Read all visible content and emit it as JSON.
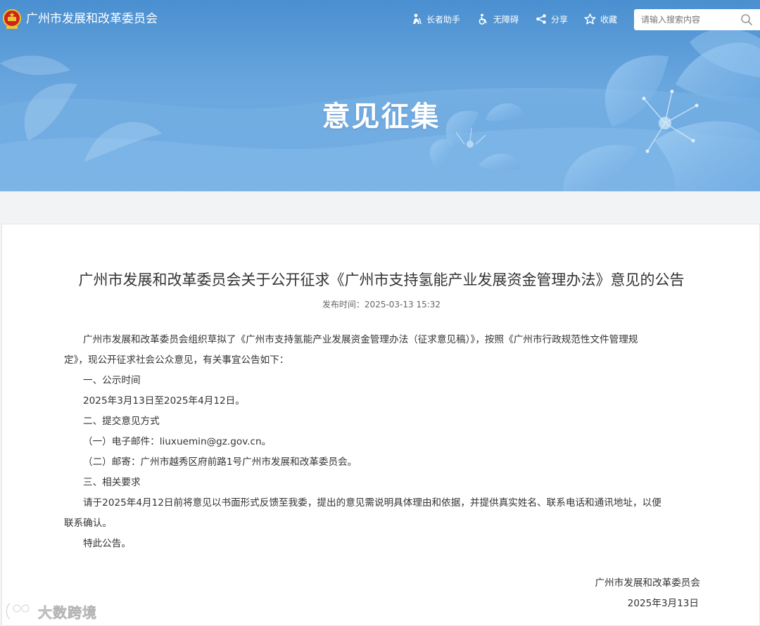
{
  "header": {
    "site_name": "广州市发展和改革委员会",
    "tools": {
      "elder": "长者助手",
      "accessibility": "无障碍",
      "share": "分享",
      "favorite": "收藏"
    },
    "search": {
      "placeholder": "请输入搜索内容"
    },
    "banner_title": "意见征集"
  },
  "article": {
    "title": "广州市发展和改革委员会关于公开征求《广州市支持氢能产业发展资金管理办法》意见的公告",
    "publish_time": "发布时间：2025-03-13 15:32",
    "paragraphs": [
      "广州市发展和改革委员会组织草拟了《广州市支持氢能产业发展资金管理办法（征求意见稿）》，按照《广州市行政规范性文件管理规",
      "定》，现公开征求社会公众意见，有关事宜公告如下：",
      "一、公示时间",
      "2025年3月13日至2025年4月12日。",
      "二、提交意见方式",
      "（一）电子邮件：liuxuemin@gz.gov.cn。",
      "（二）邮寄：广州市越秀区府前路1号广州市发展和改革委员会。",
      "三、相关要求",
      "请于2025年4月12日前将意见以书面形式反馈至我委，提出的意见需说明具体理由和依据，并提供真实姓名、联系电话和通讯地址，以便",
      "联系确认。",
      "特此公告。"
    ],
    "signature": {
      "org": "广州市发展和改革委员会",
      "date": "2025年3月13日"
    }
  },
  "watermark": {
    "text": "大数跨境"
  },
  "colors": {
    "header_blue": "#4a8fd0",
    "banner_light_blue": "#77b2e6",
    "body_text": "#333333",
    "meta_text": "#666666",
    "page_background": "#f2f3f5"
  },
  "icons": {
    "emblem": "national-emblem-icon",
    "elder": "elder-person-icon",
    "accessibility": "wheelchair-icon",
    "share": "share-icon",
    "favorite": "star-icon",
    "search": "search-icon"
  }
}
